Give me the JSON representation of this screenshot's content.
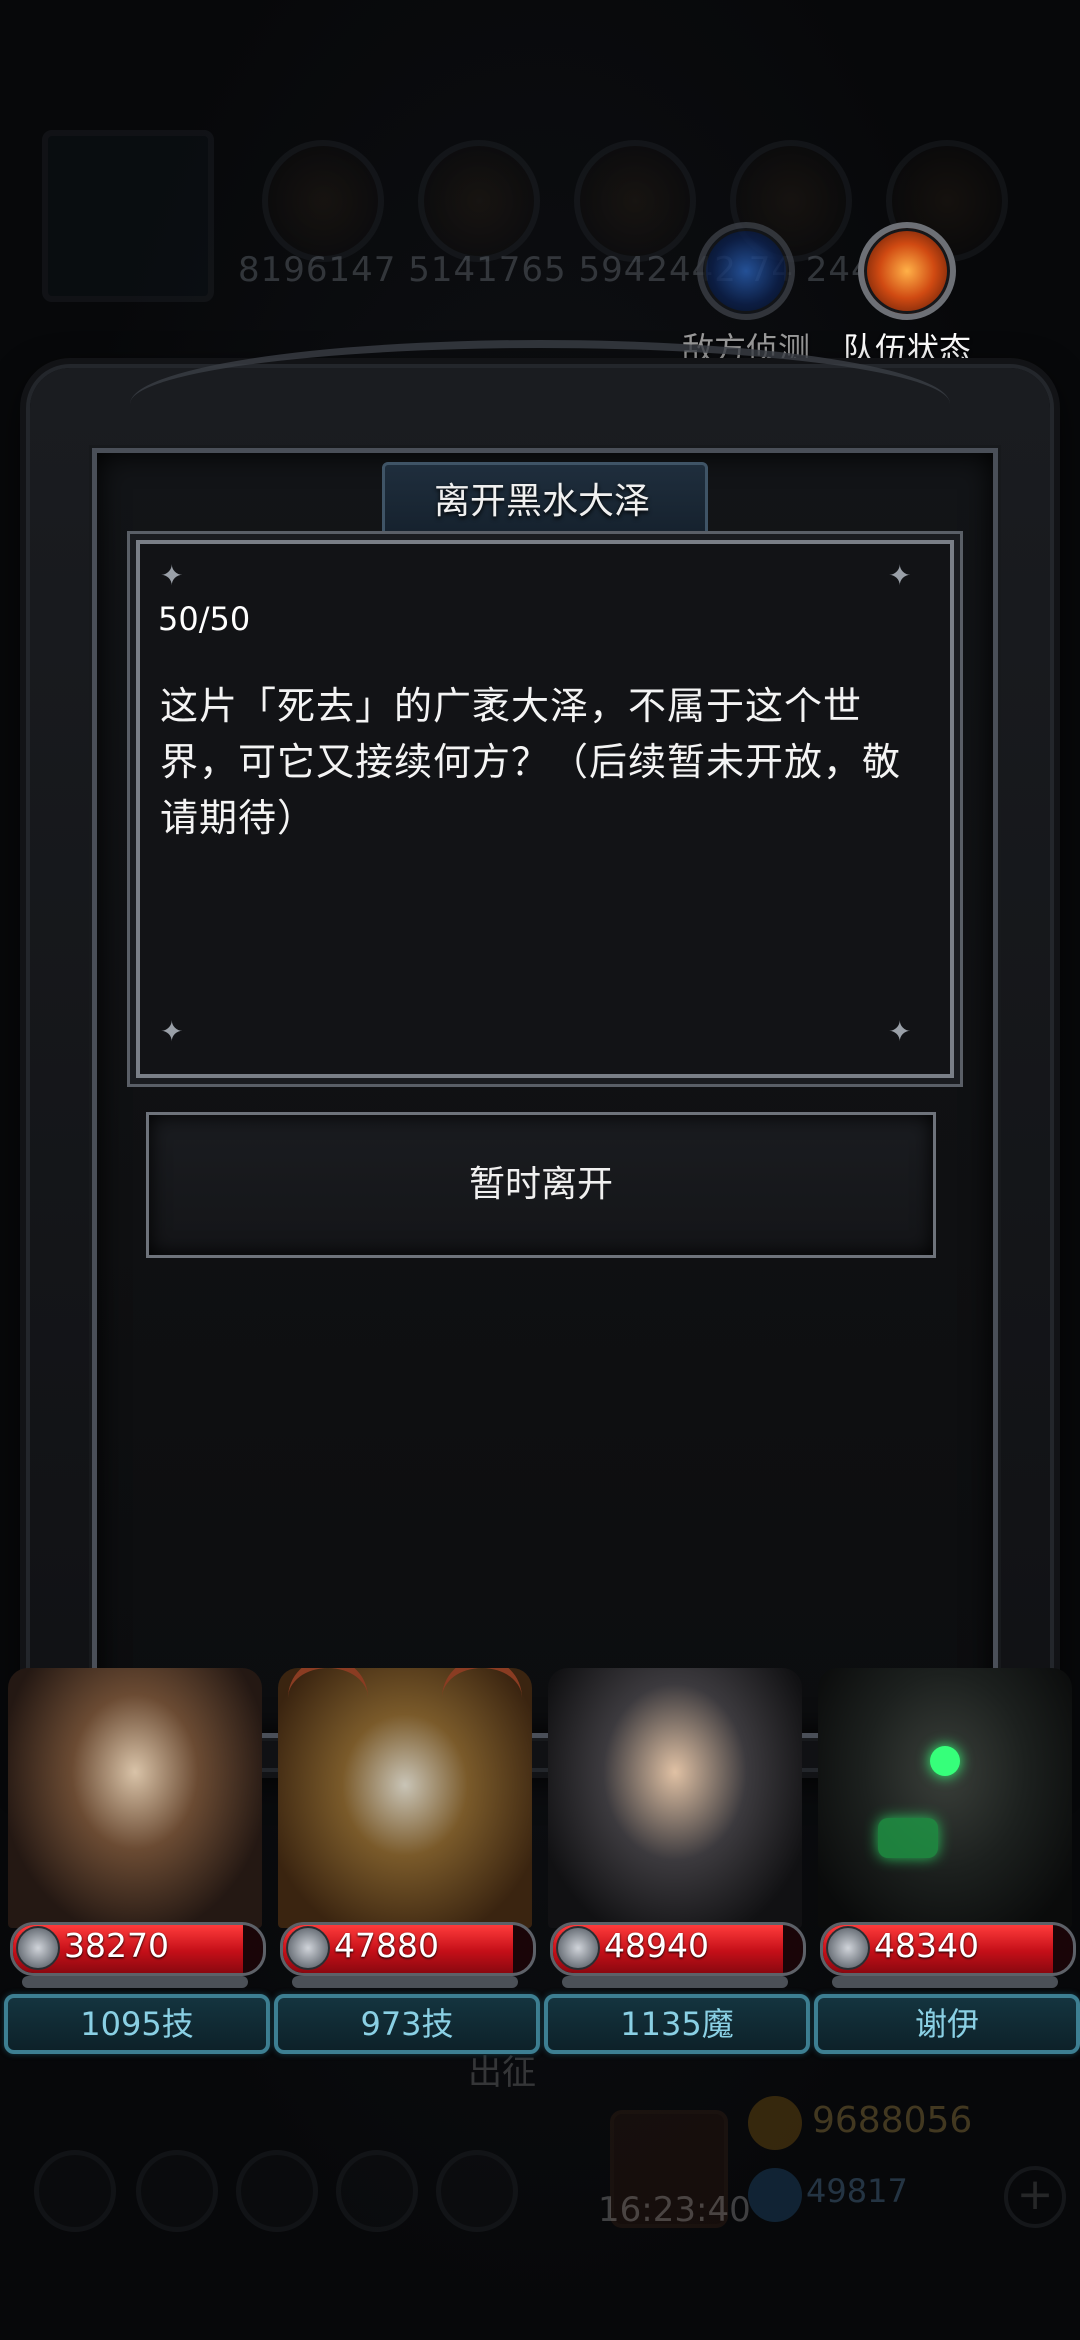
{
  "background_hud": {
    "top_stats": "8196147 5141765 5942442 74 244",
    "bottom_text": "出征",
    "clock": "16:23:40",
    "gold": "9688056",
    "gems": "49817",
    "plus_label": "+"
  },
  "hud_buttons": {
    "scout_label": "敌方侦测",
    "team_label": "队伍状态"
  },
  "dialog": {
    "title": "离开黑水大泽",
    "counter": "50/50",
    "message": "这片「死去」的广袤大泽，不属于这个世界，可它又接续何方？（后续暂未开放，敬请期待）",
    "leave_button": "暂时离开"
  },
  "party": [
    {
      "hp": "38270",
      "hp_fraction": 0.92,
      "tag": "1095技"
    },
    {
      "hp": "47880",
      "hp_fraction": 0.92,
      "tag": "973技"
    },
    {
      "hp": "48940",
      "hp_fraction": 0.92,
      "tag": "1135魔"
    },
    {
      "hp": "48340",
      "hp_fraction": 0.92,
      "tag": "谢伊"
    }
  ],
  "colors": {
    "hp_red": "#d0121a",
    "tag_cyan": "#8ad0e4",
    "frame_steel": "#4a4f58"
  }
}
